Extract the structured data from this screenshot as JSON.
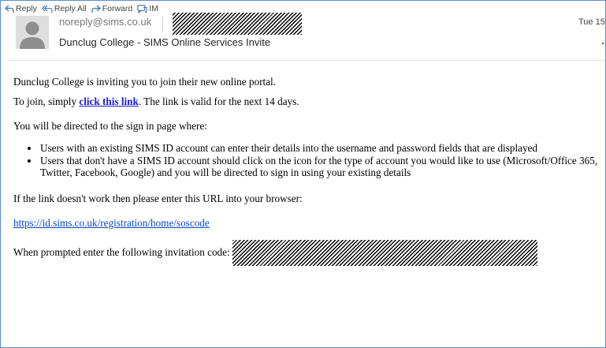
{
  "toolbar": {
    "reply_label": "Reply",
    "reply_all_label": "Reply All",
    "forward_label": "Forward",
    "im_label": "IM"
  },
  "header": {
    "sender": "noreply@sims.co.uk",
    "subject": "Dunclug College - SIMS Online Services Invite",
    "date": "Tue 15:",
    "recipient_redacted": true
  },
  "body": {
    "intro": "Dunclug College is inviting you to join their new online portal.",
    "join_prefix": "To join, simply ",
    "join_link": "click this link",
    "join_suffix": ". The link is valid for the next 14 days.",
    "directed": "You will be directed to the sign in page where:",
    "bullets": [
      "Users with an existing SIMS ID account can enter their details into the username and password fields that are displayed",
      "Users that don't have a SIMS ID account should click on the icon for the type of account you would like to use (Microsoft/Office 365, Twitter, Facebook, Google) and you will be directed to sign in using your existing details"
    ],
    "fallback": "If the link doesn't work then please enter this URL into your browser:",
    "url": "https://id.sims.co.uk/registration/home/soscode",
    "code_prompt": "When prompted enter the following invitation code:",
    "code_redacted": true
  },
  "colors": {
    "frame_border": "#5b8fc9",
    "link": "#0645c0",
    "bold_link": "#1b1bd8",
    "avatar_bg": "#dedede",
    "avatar_fg": "#8e8e8e"
  },
  "icons": [
    "reply-icon",
    "reply-all-icon",
    "forward-icon",
    "im-icon",
    "avatar-person-icon"
  ]
}
